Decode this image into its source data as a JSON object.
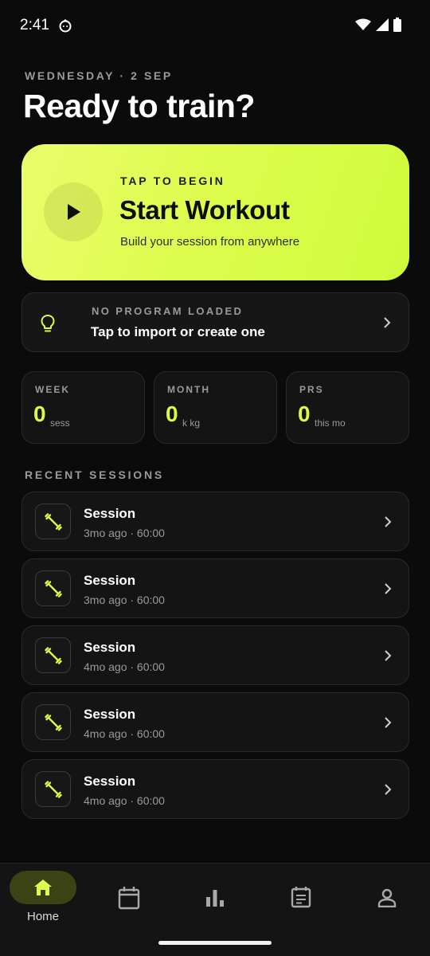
{
  "status_bar": {
    "time": "2:41"
  },
  "header": {
    "date": "WEDNESDAY · 2 SEP",
    "title": "Ready to train?"
  },
  "start_card": {
    "kicker": "TAP TO BEGIN",
    "title": "Start Workout",
    "subtitle": "Build your session from anywhere",
    "accent": "#dffc4d"
  },
  "program_card": {
    "kicker": "NO PROGRAM LOADED",
    "text": "Tap to import or create one"
  },
  "stats": [
    {
      "label": "WEEK",
      "value": "0",
      "unit": "sess"
    },
    {
      "label": "MONTH",
      "value": "0",
      "unit": "k kg"
    },
    {
      "label": "PRS",
      "value": "0",
      "unit": "this mo"
    }
  ],
  "recent": {
    "section_label": "RECENT SESSIONS",
    "sessions": [
      {
        "title": "Session",
        "meta": "3mo ago · 60:00",
        "icon": "dumbbell-icon"
      },
      {
        "title": "Session",
        "meta": "3mo ago · 60:00",
        "icon": "dumbbell-icon"
      },
      {
        "title": "Session",
        "meta": "4mo ago · 60:00",
        "icon": "dumbbell-icon"
      },
      {
        "title": "Session",
        "meta": "4mo ago · 60:00",
        "icon": "dumbbell-icon"
      },
      {
        "title": "Session",
        "meta": "4mo ago · 60:00",
        "icon": "dumbbell-icon"
      }
    ]
  },
  "bottom_nav": {
    "items": [
      {
        "label": "Home",
        "icon": "home-icon",
        "active": true
      },
      {
        "label": "",
        "icon": "calendar-icon",
        "active": false
      },
      {
        "label": "",
        "icon": "bar-chart-icon",
        "active": false
      },
      {
        "label": "",
        "icon": "schedule-icon",
        "active": false
      },
      {
        "label": "",
        "icon": "profile-icon",
        "active": false
      }
    ]
  }
}
